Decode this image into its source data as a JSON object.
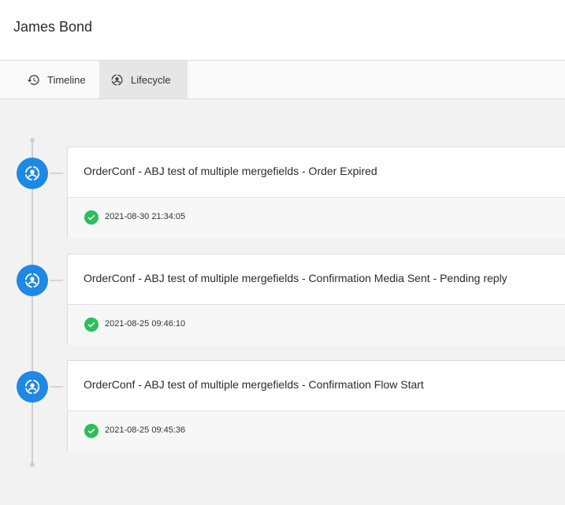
{
  "header": {
    "title": "James Bond"
  },
  "tabs": [
    {
      "label": "Timeline",
      "icon": "history-icon",
      "active": false
    },
    {
      "label": "Lifecycle",
      "icon": "lifecycle-user-icon",
      "active": true
    }
  ],
  "colors": {
    "accent": "#1e88e5",
    "success": "#2bbf5b",
    "active_tab_bg": "#e6e6e6"
  },
  "events": [
    {
      "title": "OrderConf - ABJ test of multiple mergefields - Order Expired",
      "timestamp": "2021-08-30 21:34:05",
      "status": "success"
    },
    {
      "title": "OrderConf - ABJ test of multiple mergefields - Confirmation Media Sent - Pending reply",
      "timestamp": "2021-08-25 09:46:10",
      "status": "success"
    },
    {
      "title": "OrderConf - ABJ test of multiple mergefields - Confirmation Flow Start",
      "timestamp": "2021-08-25 09:45:36",
      "status": "success"
    }
  ]
}
